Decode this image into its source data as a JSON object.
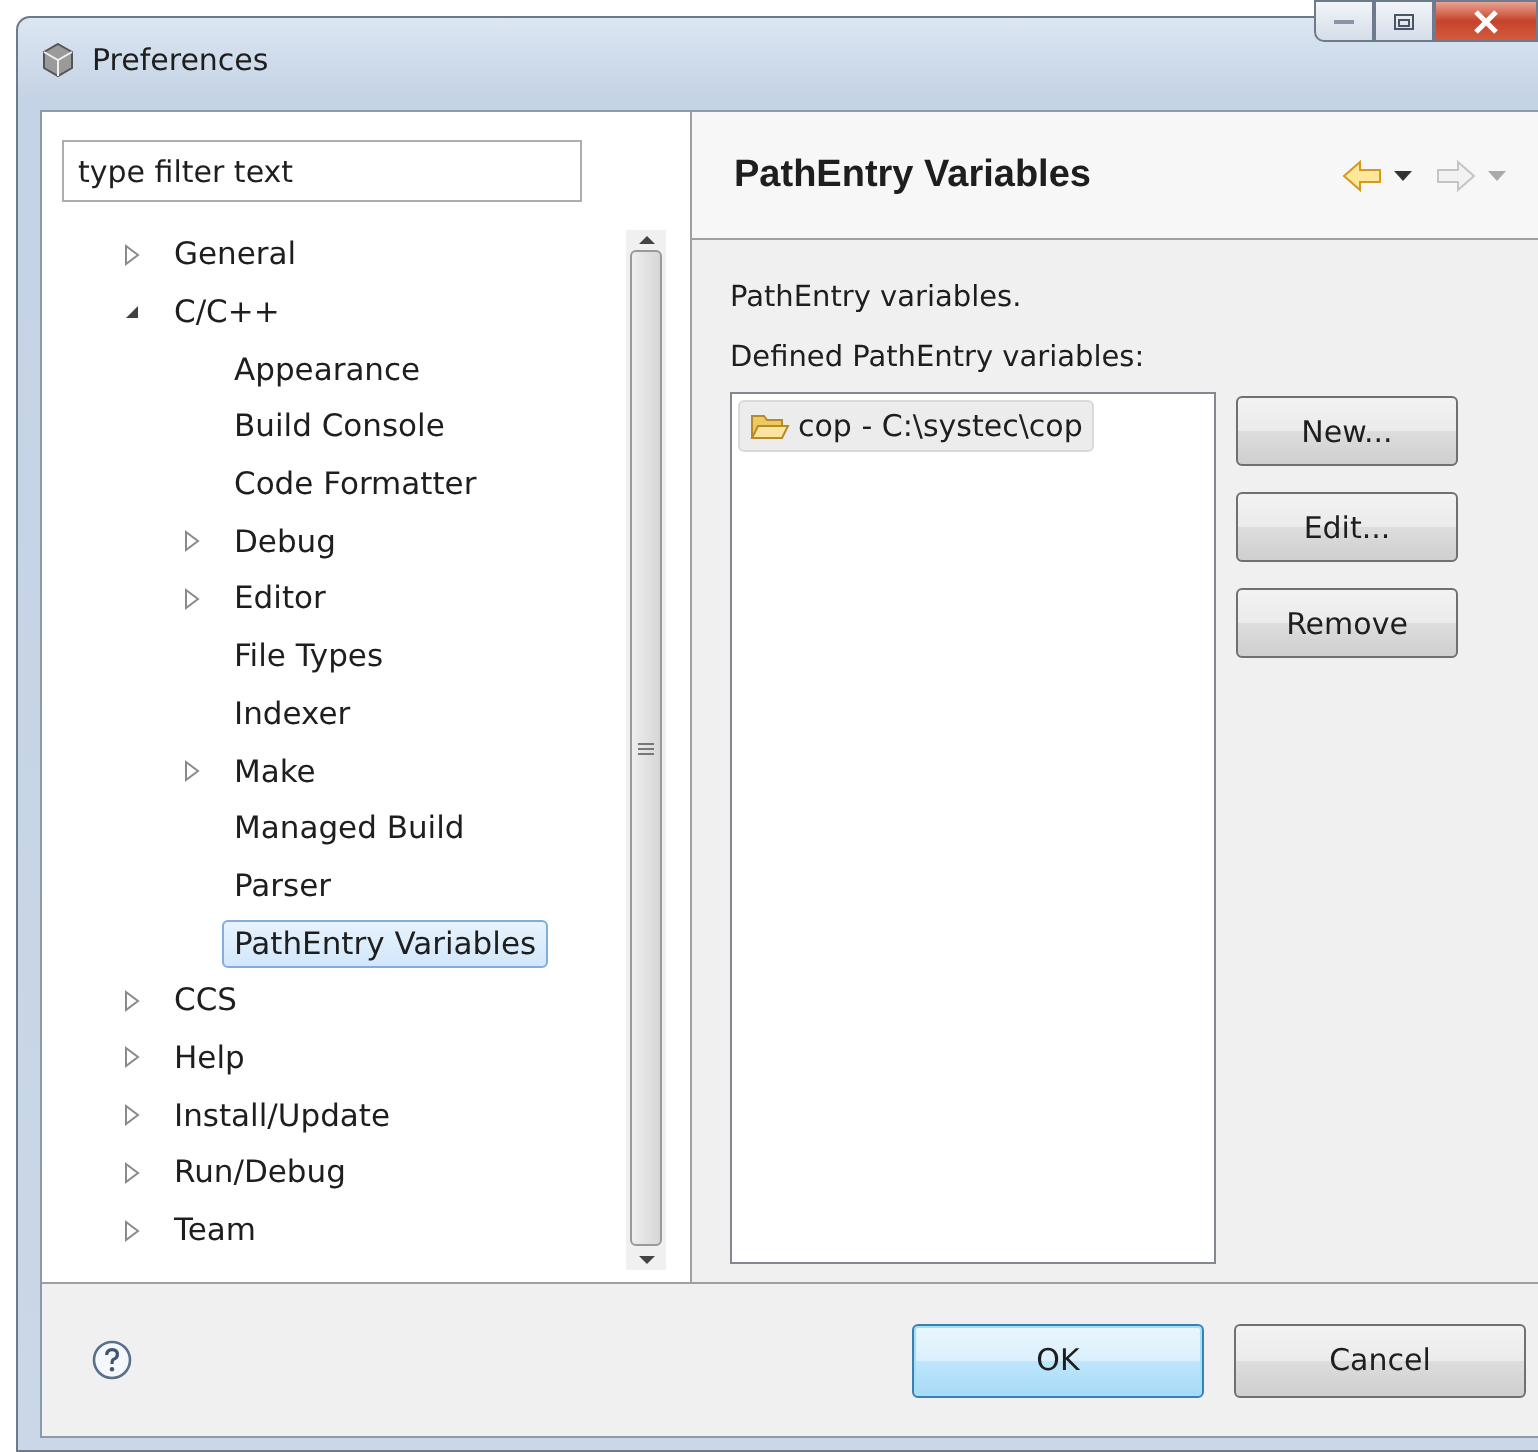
{
  "window": {
    "title": "Preferences"
  },
  "filter": {
    "placeholder": "type filter text"
  },
  "tree": [
    {
      "label": "General",
      "expanded": false,
      "selected": false
    },
    {
      "label": "C/C++",
      "expanded": true,
      "selected": false,
      "children": [
        {
          "label": "Appearance",
          "selected": false
        },
        {
          "label": "Build Console",
          "selected": false
        },
        {
          "label": "Code Formatter",
          "selected": false
        },
        {
          "label": "Debug",
          "expanded": false,
          "selected": false
        },
        {
          "label": "Editor",
          "expanded": false,
          "selected": false
        },
        {
          "label": "File Types",
          "selected": false
        },
        {
          "label": "Indexer",
          "selected": false
        },
        {
          "label": "Make",
          "expanded": false,
          "selected": false
        },
        {
          "label": "Managed Build",
          "selected": false
        },
        {
          "label": "Parser",
          "selected": false
        },
        {
          "label": "PathEntry Variables",
          "selected": true
        }
      ]
    },
    {
      "label": "CCS",
      "expanded": false,
      "selected": false
    },
    {
      "label": "Help",
      "expanded": false,
      "selected": false
    },
    {
      "label": "Install/Update",
      "expanded": false,
      "selected": false
    },
    {
      "label": "Run/Debug",
      "expanded": false,
      "selected": false
    },
    {
      "label": "Team",
      "expanded": false,
      "selected": false
    }
  ],
  "page": {
    "title": "PathEntry Variables",
    "nav": [
      {
        "kind": "back",
        "disabled": false
      },
      {
        "kind": "forward",
        "disabled": true
      }
    ],
    "description": "PathEntry variables.",
    "list_label": "Defined PathEntry variables:",
    "variables": [
      {
        "label": "cop - C:\\systec\\cop",
        "selected": true
      }
    ],
    "buttons": [
      "New...",
      "Edit...",
      "Remove"
    ]
  },
  "footer_buttons": [
    {
      "label": "OK",
      "default": true
    },
    {
      "label": "Cancel",
      "default": false
    }
  ]
}
